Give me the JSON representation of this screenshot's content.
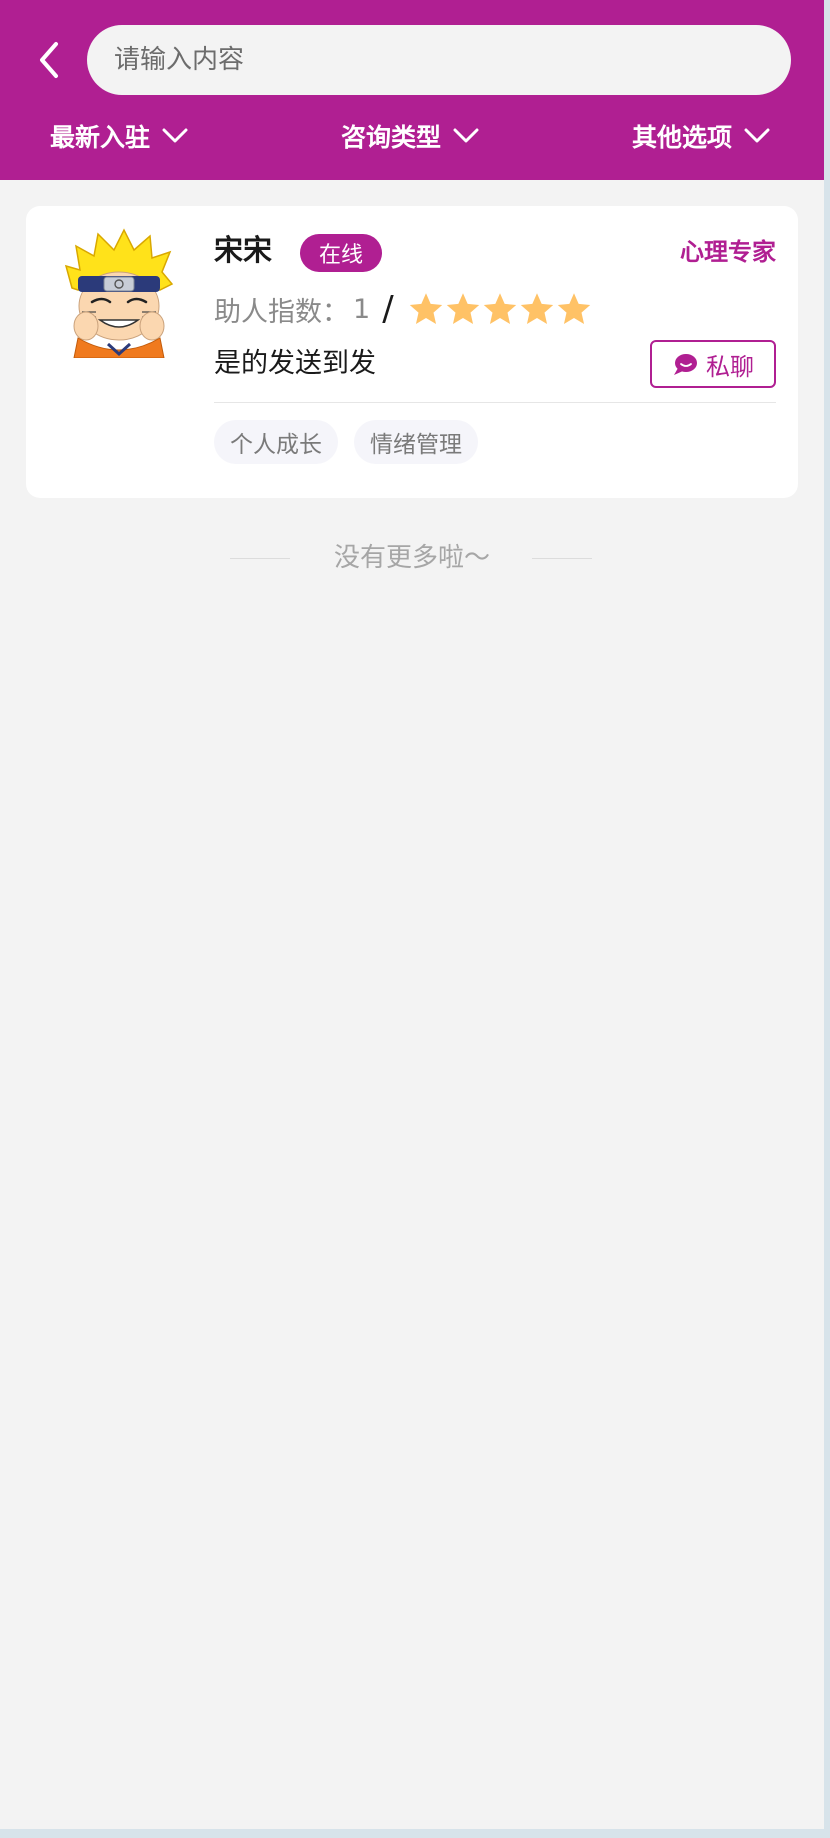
{
  "header": {
    "back_icon": "chevron-left-icon",
    "search": {
      "placeholder": "请输入内容",
      "value": ""
    },
    "filters": [
      {
        "label": "最新入驻",
        "icon": "chevron-down-icon"
      },
      {
        "label": "咨询类型",
        "icon": "chevron-down-icon"
      },
      {
        "label": "其他选项",
        "icon": "chevron-down-icon"
      }
    ]
  },
  "counselor": {
    "name": "宋宋",
    "status": "在线",
    "role": "心理专家",
    "index_label": "助人指数：",
    "index_value": "1",
    "separator": "/",
    "rating": 5,
    "rating_max": 5,
    "description": "是的发送到发",
    "chat_label": "私聊",
    "chat_icon": "chat-bubble-icon",
    "tags": [
      "个人成长",
      "情绪管理"
    ]
  },
  "footer": {
    "no_more": "没有更多啦～"
  },
  "colors": {
    "brand": "#b01f92",
    "star": "#ffc266",
    "background": "#f3f3f3"
  }
}
